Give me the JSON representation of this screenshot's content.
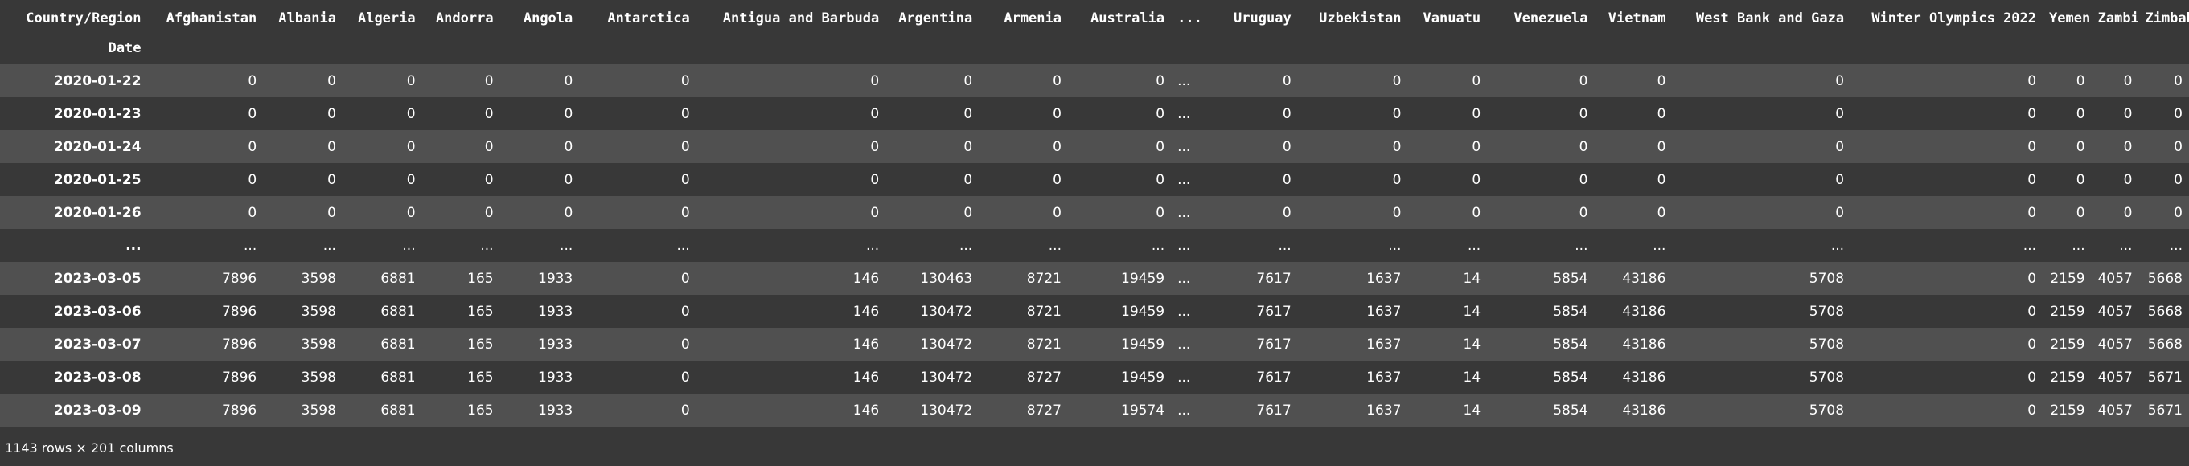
{
  "table": {
    "columns_name": "Country/Region",
    "index_name": "Date",
    "columns": [
      "Afghanistan",
      "Albania",
      "Algeria",
      "Andorra",
      "Angola",
      "Antarctica",
      "Antigua and Barbuda",
      "Argentina",
      "Armenia",
      "Australia",
      "...",
      "Uruguay",
      "Uzbekistan",
      "Vanuatu",
      "Venezuela",
      "Vietnam",
      "West Bank and Gaza",
      "Winter Olympics 2022",
      "Yemen",
      "Zambia",
      "Zimbabwe"
    ],
    "rows": [
      {
        "date": "2020-01-22",
        "cells": [
          "0",
          "0",
          "0",
          "0",
          "0",
          "0",
          "0",
          "0",
          "0",
          "0",
          "...",
          "0",
          "0",
          "0",
          "0",
          "0",
          "0",
          "0",
          "0",
          "0",
          "0"
        ]
      },
      {
        "date": "2020-01-23",
        "cells": [
          "0",
          "0",
          "0",
          "0",
          "0",
          "0",
          "0",
          "0",
          "0",
          "0",
          "...",
          "0",
          "0",
          "0",
          "0",
          "0",
          "0",
          "0",
          "0",
          "0",
          "0"
        ]
      },
      {
        "date": "2020-01-24",
        "cells": [
          "0",
          "0",
          "0",
          "0",
          "0",
          "0",
          "0",
          "0",
          "0",
          "0",
          "...",
          "0",
          "0",
          "0",
          "0",
          "0",
          "0",
          "0",
          "0",
          "0",
          "0"
        ]
      },
      {
        "date": "2020-01-25",
        "cells": [
          "0",
          "0",
          "0",
          "0",
          "0",
          "0",
          "0",
          "0",
          "0",
          "0",
          "...",
          "0",
          "0",
          "0",
          "0",
          "0",
          "0",
          "0",
          "0",
          "0",
          "0"
        ]
      },
      {
        "date": "2020-01-26",
        "cells": [
          "0",
          "0",
          "0",
          "0",
          "0",
          "0",
          "0",
          "0",
          "0",
          "0",
          "...",
          "0",
          "0",
          "0",
          "0",
          "0",
          "0",
          "0",
          "0",
          "0",
          "0"
        ]
      },
      {
        "date": "...",
        "cells": [
          "...",
          "...",
          "...",
          "...",
          "...",
          "...",
          "...",
          "...",
          "...",
          "...",
          "...",
          "...",
          "...",
          "...",
          "...",
          "...",
          "...",
          "...",
          "...",
          "...",
          "..."
        ]
      },
      {
        "date": "2023-03-05",
        "cells": [
          "7896",
          "3598",
          "6881",
          "165",
          "1933",
          "0",
          "146",
          "130463",
          "8721",
          "19459",
          "...",
          "7617",
          "1637",
          "14",
          "5854",
          "43186",
          "5708",
          "0",
          "2159",
          "4057",
          "5668"
        ]
      },
      {
        "date": "2023-03-06",
        "cells": [
          "7896",
          "3598",
          "6881",
          "165",
          "1933",
          "0",
          "146",
          "130472",
          "8721",
          "19459",
          "...",
          "7617",
          "1637",
          "14",
          "5854",
          "43186",
          "5708",
          "0",
          "2159",
          "4057",
          "5668"
        ]
      },
      {
        "date": "2023-03-07",
        "cells": [
          "7896",
          "3598",
          "6881",
          "165",
          "1933",
          "0",
          "146",
          "130472",
          "8721",
          "19459",
          "...",
          "7617",
          "1637",
          "14",
          "5854",
          "43186",
          "5708",
          "0",
          "2159",
          "4057",
          "5668"
        ]
      },
      {
        "date": "2023-03-08",
        "cells": [
          "7896",
          "3598",
          "6881",
          "165",
          "1933",
          "0",
          "146",
          "130472",
          "8727",
          "19459",
          "...",
          "7617",
          "1637",
          "14",
          "5854",
          "43186",
          "5708",
          "0",
          "2159",
          "4057",
          "5671"
        ]
      },
      {
        "date": "2023-03-09",
        "cells": [
          "7896",
          "3598",
          "6881",
          "165",
          "1933",
          "0",
          "146",
          "130472",
          "8727",
          "19574",
          "...",
          "7617",
          "1637",
          "14",
          "5854",
          "43186",
          "5708",
          "0",
          "2159",
          "4057",
          "5671"
        ]
      }
    ]
  },
  "footer": "1143 rows × 201 columns",
  "colors": {
    "background": "#383838",
    "stripe": "#505050",
    "text": "#ffffff"
  }
}
